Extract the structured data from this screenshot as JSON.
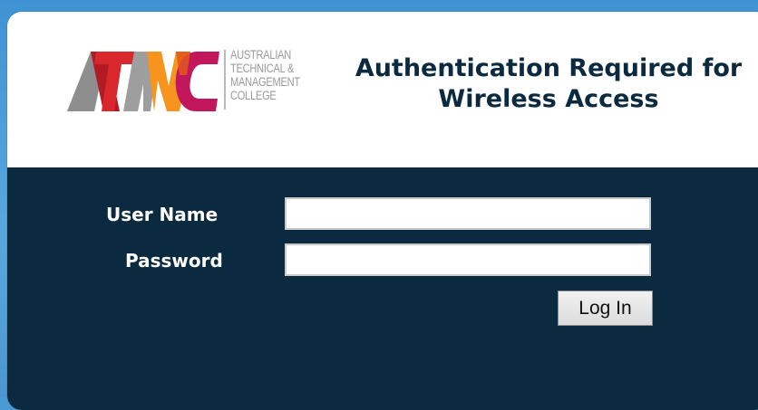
{
  "logo": {
    "lines": [
      "AUSTRALIAN",
      "TECHNICAL &",
      "MANAGEMENT",
      "COLLEGE"
    ],
    "colors": {
      "grey": "#8e8e8e",
      "red": "#d8272d",
      "orange": "#f7941d",
      "magenta": "#c2185b"
    }
  },
  "header": {
    "title_line1": "Authentication Required for",
    "title_line2": "Wireless Access"
  },
  "form": {
    "username_label": "User Name",
    "username_value": "",
    "password_label": "Password",
    "password_value": "",
    "login_label": "Log In"
  },
  "theme": {
    "panel_color": "#0b2a3f",
    "header_color": "#ffffff",
    "background_color": "#4a9ad6"
  }
}
